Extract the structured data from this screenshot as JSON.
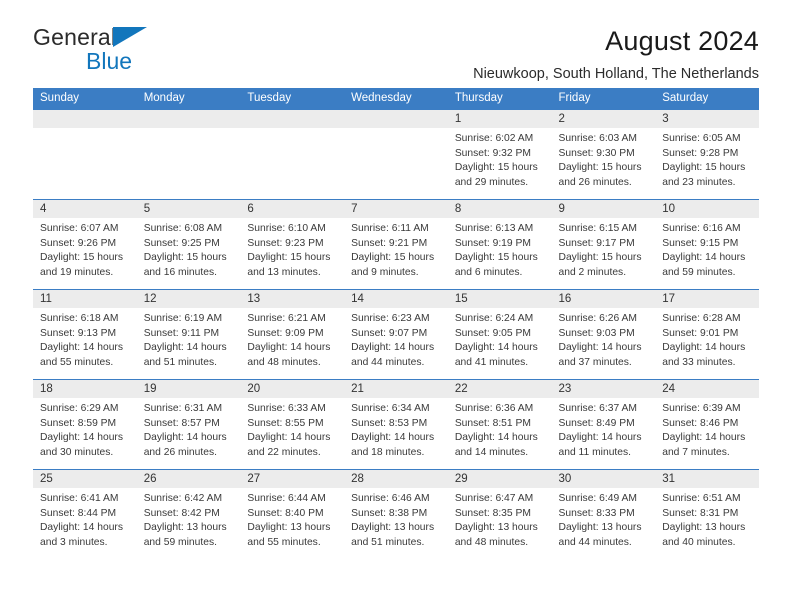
{
  "brand": {
    "name_part1": "General",
    "name_part2": "Blue",
    "triangle_color": "#1276bc"
  },
  "header": {
    "title": "August 2024",
    "subtitle": "Nieuwkoop, South Holland, The Netherlands"
  },
  "theme": {
    "header_blue": "#3b7dc4",
    "daynum_gray": "#ececec",
    "text": "#333333"
  },
  "calendar": {
    "weekday_headers": [
      "Sunday",
      "Monday",
      "Tuesday",
      "Wednesday",
      "Thursday",
      "Friday",
      "Saturday"
    ],
    "weeks": [
      [
        {
          "day": "",
          "lines": []
        },
        {
          "day": "",
          "lines": []
        },
        {
          "day": "",
          "lines": []
        },
        {
          "day": "",
          "lines": []
        },
        {
          "day": "1",
          "lines": [
            "Sunrise: 6:02 AM",
            "Sunset: 9:32 PM",
            "Daylight: 15 hours",
            "and 29 minutes."
          ]
        },
        {
          "day": "2",
          "lines": [
            "Sunrise: 6:03 AM",
            "Sunset: 9:30 PM",
            "Daylight: 15 hours",
            "and 26 minutes."
          ]
        },
        {
          "day": "3",
          "lines": [
            "Sunrise: 6:05 AM",
            "Sunset: 9:28 PM",
            "Daylight: 15 hours",
            "and 23 minutes."
          ]
        }
      ],
      [
        {
          "day": "4",
          "lines": [
            "Sunrise: 6:07 AM",
            "Sunset: 9:26 PM",
            "Daylight: 15 hours",
            "and 19 minutes."
          ]
        },
        {
          "day": "5",
          "lines": [
            "Sunrise: 6:08 AM",
            "Sunset: 9:25 PM",
            "Daylight: 15 hours",
            "and 16 minutes."
          ]
        },
        {
          "day": "6",
          "lines": [
            "Sunrise: 6:10 AM",
            "Sunset: 9:23 PM",
            "Daylight: 15 hours",
            "and 13 minutes."
          ]
        },
        {
          "day": "7",
          "lines": [
            "Sunrise: 6:11 AM",
            "Sunset: 9:21 PM",
            "Daylight: 15 hours",
            "and 9 minutes."
          ]
        },
        {
          "day": "8",
          "lines": [
            "Sunrise: 6:13 AM",
            "Sunset: 9:19 PM",
            "Daylight: 15 hours",
            "and 6 minutes."
          ]
        },
        {
          "day": "9",
          "lines": [
            "Sunrise: 6:15 AM",
            "Sunset: 9:17 PM",
            "Daylight: 15 hours",
            "and 2 minutes."
          ]
        },
        {
          "day": "10",
          "lines": [
            "Sunrise: 6:16 AM",
            "Sunset: 9:15 PM",
            "Daylight: 14 hours",
            "and 59 minutes."
          ]
        }
      ],
      [
        {
          "day": "11",
          "lines": [
            "Sunrise: 6:18 AM",
            "Sunset: 9:13 PM",
            "Daylight: 14 hours",
            "and 55 minutes."
          ]
        },
        {
          "day": "12",
          "lines": [
            "Sunrise: 6:19 AM",
            "Sunset: 9:11 PM",
            "Daylight: 14 hours",
            "and 51 minutes."
          ]
        },
        {
          "day": "13",
          "lines": [
            "Sunrise: 6:21 AM",
            "Sunset: 9:09 PM",
            "Daylight: 14 hours",
            "and 48 minutes."
          ]
        },
        {
          "day": "14",
          "lines": [
            "Sunrise: 6:23 AM",
            "Sunset: 9:07 PM",
            "Daylight: 14 hours",
            "and 44 minutes."
          ]
        },
        {
          "day": "15",
          "lines": [
            "Sunrise: 6:24 AM",
            "Sunset: 9:05 PM",
            "Daylight: 14 hours",
            "and 41 minutes."
          ]
        },
        {
          "day": "16",
          "lines": [
            "Sunrise: 6:26 AM",
            "Sunset: 9:03 PM",
            "Daylight: 14 hours",
            "and 37 minutes."
          ]
        },
        {
          "day": "17",
          "lines": [
            "Sunrise: 6:28 AM",
            "Sunset: 9:01 PM",
            "Daylight: 14 hours",
            "and 33 minutes."
          ]
        }
      ],
      [
        {
          "day": "18",
          "lines": [
            "Sunrise: 6:29 AM",
            "Sunset: 8:59 PM",
            "Daylight: 14 hours",
            "and 30 minutes."
          ]
        },
        {
          "day": "19",
          "lines": [
            "Sunrise: 6:31 AM",
            "Sunset: 8:57 PM",
            "Daylight: 14 hours",
            "and 26 minutes."
          ]
        },
        {
          "day": "20",
          "lines": [
            "Sunrise: 6:33 AM",
            "Sunset: 8:55 PM",
            "Daylight: 14 hours",
            "and 22 minutes."
          ]
        },
        {
          "day": "21",
          "lines": [
            "Sunrise: 6:34 AM",
            "Sunset: 8:53 PM",
            "Daylight: 14 hours",
            "and 18 minutes."
          ]
        },
        {
          "day": "22",
          "lines": [
            "Sunrise: 6:36 AM",
            "Sunset: 8:51 PM",
            "Daylight: 14 hours",
            "and 14 minutes."
          ]
        },
        {
          "day": "23",
          "lines": [
            "Sunrise: 6:37 AM",
            "Sunset: 8:49 PM",
            "Daylight: 14 hours",
            "and 11 minutes."
          ]
        },
        {
          "day": "24",
          "lines": [
            "Sunrise: 6:39 AM",
            "Sunset: 8:46 PM",
            "Daylight: 14 hours",
            "and 7 minutes."
          ]
        }
      ],
      [
        {
          "day": "25",
          "lines": [
            "Sunrise: 6:41 AM",
            "Sunset: 8:44 PM",
            "Daylight: 14 hours",
            "and 3 minutes."
          ]
        },
        {
          "day": "26",
          "lines": [
            "Sunrise: 6:42 AM",
            "Sunset: 8:42 PM",
            "Daylight: 13 hours",
            "and 59 minutes."
          ]
        },
        {
          "day": "27",
          "lines": [
            "Sunrise: 6:44 AM",
            "Sunset: 8:40 PM",
            "Daylight: 13 hours",
            "and 55 minutes."
          ]
        },
        {
          "day": "28",
          "lines": [
            "Sunrise: 6:46 AM",
            "Sunset: 8:38 PM",
            "Daylight: 13 hours",
            "and 51 minutes."
          ]
        },
        {
          "day": "29",
          "lines": [
            "Sunrise: 6:47 AM",
            "Sunset: 8:35 PM",
            "Daylight: 13 hours",
            "and 48 minutes."
          ]
        },
        {
          "day": "30",
          "lines": [
            "Sunrise: 6:49 AM",
            "Sunset: 8:33 PM",
            "Daylight: 13 hours",
            "and 44 minutes."
          ]
        },
        {
          "day": "31",
          "lines": [
            "Sunrise: 6:51 AM",
            "Sunset: 8:31 PM",
            "Daylight: 13 hours",
            "and 40 minutes."
          ]
        }
      ]
    ]
  }
}
